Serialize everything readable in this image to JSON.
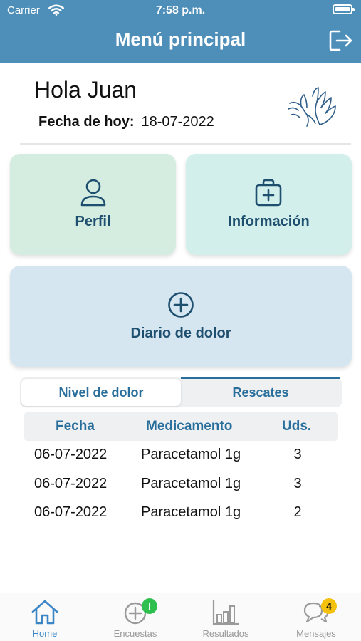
{
  "status_bar": {
    "carrier": "Carrier",
    "time": "7:58 p.m."
  },
  "header": {
    "title": "Menú principal",
    "logout_icon": "logout-icon"
  },
  "greeting": {
    "text": "Hola Juan",
    "date_label": "Fecha de hoy:",
    "date_value": "18-07-2022"
  },
  "tiles": {
    "profile": {
      "label": "Perfil",
      "icon": "user-icon"
    },
    "info": {
      "label": "Información",
      "icon": "first-aid-bag-icon"
    },
    "diary": {
      "label": "Diario de dolor",
      "icon": "plus-circle-icon"
    }
  },
  "segmented": {
    "left": "Nivel de dolor",
    "right": "Rescates",
    "selected": "Nivel de dolor"
  },
  "table": {
    "headers": [
      "Fecha",
      "Medicamento",
      "Uds."
    ],
    "rows": [
      [
        "06-07-2022",
        "Paracetamol 1g",
        "3"
      ],
      [
        "06-07-2022",
        "Paracetamol 1g",
        "3"
      ],
      [
        "06-07-2022",
        "Paracetamol 1g",
        "2"
      ]
    ]
  },
  "tabbar": {
    "items": [
      {
        "label": "Home",
        "icon": "home-icon",
        "active": true
      },
      {
        "label": "Encuestas",
        "icon": "plus-circle-icon",
        "badge": "!"
      },
      {
        "label": "Resultados",
        "icon": "bar-chart-icon"
      },
      {
        "label": "Mensajes",
        "icon": "chat-bubbles-icon",
        "badge": "4"
      }
    ]
  },
  "colors": {
    "header": "#4e8fba",
    "profile_tile": "#d4ede0",
    "info_tile": "#d2efeb",
    "diary_tile": "#d6e6f1",
    "accent": "#2a6f9c",
    "active_tab": "#3b86c6",
    "badge_green": "#2fbf4f",
    "badge_yellow": "#f4c20d"
  }
}
